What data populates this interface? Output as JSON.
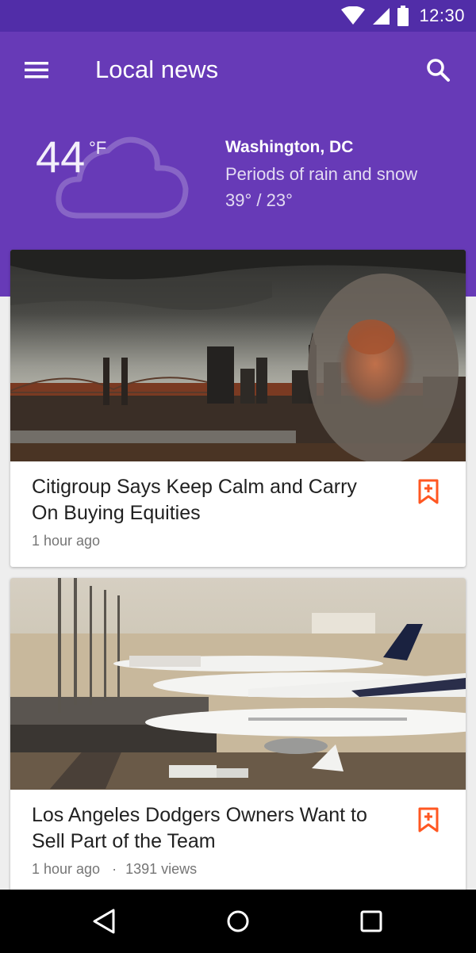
{
  "status_bar": {
    "time": "12:30",
    "icons": [
      "wifi-icon",
      "cellular-signal-icon",
      "battery-icon"
    ]
  },
  "app_bar": {
    "title": "Local news",
    "left_icon": "menu-icon",
    "right_icon": "search-icon"
  },
  "weather": {
    "temperature": "44",
    "unit": "°F",
    "icon": "cloud-icon",
    "location": "Washington, DC",
    "condition": "Periods of rain and snow",
    "range": "39° / 23°"
  },
  "articles": [
    {
      "title": "Citigroup Says Keep Calm and Carry On Buying Equities",
      "time": "1 hour ago",
      "views": "",
      "image": "city-skyline-bridge-photo",
      "action_icon": "bookmark-add-icon"
    },
    {
      "title": "Los Angeles Dodgers Owners Want to Sell Part of the Team",
      "time": "1 hour ago",
      "views": "1391 views",
      "image": "airport-airplanes-photo",
      "action_icon": "bookmark-add-icon"
    }
  ],
  "nav_bar": {
    "icons": [
      "back-icon",
      "home-icon",
      "recents-icon"
    ]
  },
  "colors": {
    "status_bar": "#512DA8",
    "primary": "#673AB7",
    "accent": "#FF5722",
    "background": "#EEEEEE"
  }
}
